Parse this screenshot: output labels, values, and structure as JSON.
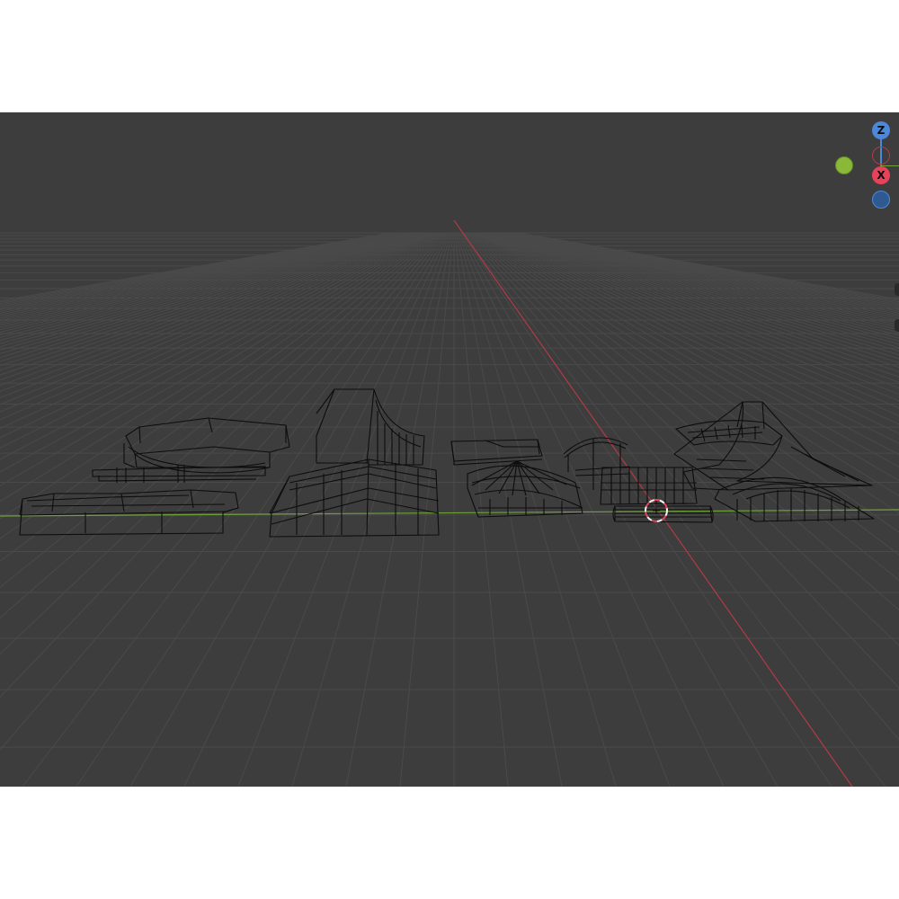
{
  "app": {
    "name": "3D Viewport"
  },
  "colors": {
    "viewport_bg": "#3d3d3d",
    "grid_line": "#4a4a4a",
    "x_axis": "#b33a48",
    "y_axis": "#6fa23a",
    "wireframe": "#0d0d0d",
    "gizmo_z": "#4c88d9",
    "gizmo_x": "#e8415a",
    "gizmo_y": "#8ab93a",
    "cursor_red": "#e0465a",
    "cursor_white": "#f2f2f2"
  },
  "gizmo": {
    "z_label": "Z",
    "x_label": "X"
  },
  "icons": {
    "gizmo": "navigation-gizmo-icon",
    "cursor": "3d-cursor-icon"
  }
}
